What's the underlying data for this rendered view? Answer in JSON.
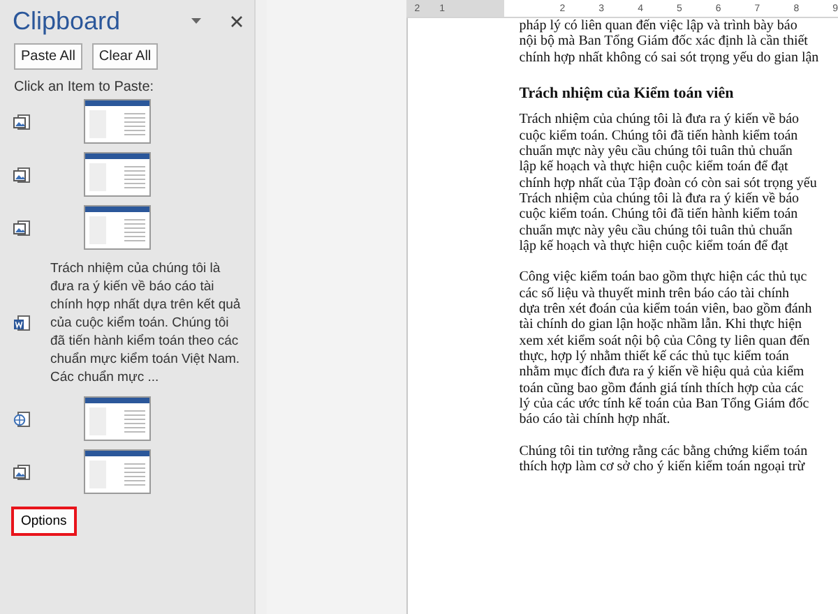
{
  "clipboard": {
    "title": "Clipboard",
    "buttons": [
      "Paste All",
      "Clear All"
    ],
    "hint": "Click an Item to Paste:",
    "items": [
      {
        "kind": "picture"
      },
      {
        "kind": "picture"
      },
      {
        "kind": "picture"
      },
      {
        "kind": "text",
        "text": "Trách nhiệm của chúng tôi là đưa ra ý kiến về báo cáo tài chính hợp nhất dựa trên kết quả của cuộc kiểm toán. Chúng tôi đã tiến hành kiểm toán theo các chuẩn mực kiểm toán Việt Nam. Các chuẩn mực ..."
      },
      {
        "kind": "web-picture"
      },
      {
        "kind": "picture"
      }
    ],
    "options": {
      "label": "Options",
      "highlighted": true
    }
  },
  "ruler": {
    "left_numbers": [
      "2",
      "1"
    ],
    "right_numbers": [
      "2",
      "3",
      "4",
      "5",
      "6",
      "7",
      "8",
      "9"
    ]
  },
  "document": {
    "blocks": [
      {
        "kind": "paragraph",
        "lines": [
          "pháp lý có liên quan đến việc lập và trình bày báo",
          "nội bộ mà Ban Tổng Giám đốc xác định là cần thiết",
          "chính hợp nhất không có sai sót trọng yếu do gian lận"
        ]
      },
      {
        "kind": "heading",
        "lines": [
          "Trách nhiệm của Kiểm toán viên"
        ]
      },
      {
        "kind": "paragraph",
        "lines": [
          "Trách nhiệm của chúng tôi là đưa ra ý kiến về báo",
          "cuộc kiểm toán. Chúng tôi đã tiến hành kiểm toán",
          "chuẩn mực này yêu cầu chúng tôi tuân thủ chuẩn",
          "lập kế hoạch và thực hiện cuộc kiểm toán để đạt",
          "chính hợp nhất của Tập đoàn có còn sai sót trọng yếu",
          "Trách nhiệm của chúng tôi là đưa ra ý kiến về báo",
          "cuộc kiểm toán. Chúng tôi đã tiến hành kiểm toán",
          "chuẩn mực này yêu cầu chúng tôi tuân thủ chuẩn",
          "lập kế hoạch và thực hiện cuộc kiểm toán để đạt"
        ]
      },
      {
        "kind": "paragraph",
        "lines": [
          "Công việc kiểm toán bao gồm thực hiện các thủ tục",
          "các số liệu và thuyết minh trên báo cáo tài chính",
          "dựa trên xét đoán của kiểm toán viên, bao gồm đánh",
          "tài chính do gian lận hoặc nhầm lẫn. Khi thực hiện",
          "xem xét kiểm soát nội bộ của Công ty liên quan đến",
          "thực, hợp lý nhằm thiết kế các thủ tục kiểm toán",
          "nhằm mục đích đưa ra ý kiến về hiệu quả của kiểm",
          "toán cũng bao gồm đánh giá tính thích hợp của các",
          "lý của các ước tính kế toán của Ban Tổng Giám đốc",
          "báo cáo tài chính hợp nhất."
        ]
      },
      {
        "kind": "paragraph",
        "lines": [
          "Chúng tôi tin tưởng rằng các bằng chứng kiểm toán",
          "thích hợp làm cơ sở cho ý kiến kiểm toán ngoại trừ"
        ]
      }
    ]
  }
}
